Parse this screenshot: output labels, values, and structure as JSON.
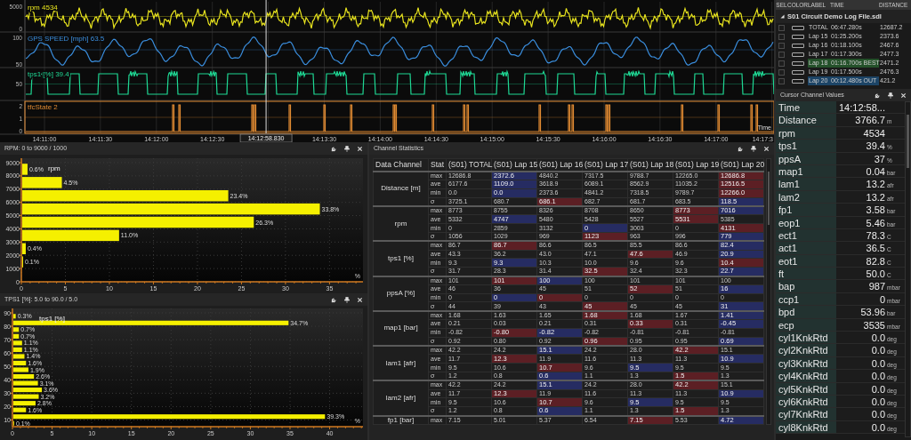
{
  "traces": {
    "lines": [
      {
        "label": "rpm 4534",
        "kind": "jagged",
        "color": "#e8e41e",
        "yticks": [
          "5000",
          "0"
        ]
      },
      {
        "label": "GPS SPEED [mph] 63.5",
        "kind": "smooth",
        "color": "#3a8ddc",
        "yticks": [
          "100",
          "50"
        ]
      },
      {
        "label": "tps1 [%] 39.4",
        "kind": "square",
        "color": "#1fd894",
        "yticks": [
          "50"
        ]
      },
      {
        "label": "tfcState 2",
        "kind": "spikes",
        "color": "#e08a32",
        "yticks": [
          "2",
          "1",
          "0"
        ]
      }
    ],
    "time_ticks": [
      "14:11:00",
      "14:11:30",
      "14:12:00",
      "14:12:30",
      "14:13:30",
      "14:14:00",
      "14:14:30",
      "14:15:00",
      "14:15:30",
      "14:16:00",
      "14:16:30",
      "14:17:00",
      "14:17:3"
    ],
    "cursor_time": "14:12:58.830",
    "axis_label": "Time"
  },
  "histograms": [
    {
      "title": "RPM: 0 to 9000 / 1000",
      "chart_data": {
        "type": "bar",
        "orientation": "horizontal",
        "grid": true,
        "xlabel": "%",
        "x": [
          1500,
          2500,
          3500,
          4500,
          5500,
          6500,
          7500,
          8500
        ],
        "series": [
          {
            "name": "rpm",
            "color": "#f5f000",
            "values": [
              0.1,
              0.4,
              11.0,
              26.3,
              33.8,
              23.4,
              4.5,
              0.6
            ]
          }
        ],
        "value_labels": [
          "0.1%",
          "0.4%",
          "11.0%",
          "26.3%",
          "33.8%",
          "23.4%",
          "4.5%",
          "0.6%"
        ],
        "xlim": [
          0,
          38.8
        ],
        "ylim": [
          0,
          9000
        ],
        "xticks": [
          0,
          5,
          10,
          15,
          20,
          25,
          30,
          35
        ],
        "yticks": [
          0,
          1000,
          2000,
          3000,
          4000,
          5000,
          6000,
          7000,
          8000,
          9000
        ]
      }
    },
    {
      "title": "TPS1 [%]: 5.0 to 90.0 / 5.0",
      "chart_data": {
        "type": "bar",
        "orientation": "horizontal",
        "grid": true,
        "xlabel": "%",
        "x": [
          7.5,
          12.5,
          17.5,
          22.5,
          27.5,
          32.5,
          37.5,
          42.5,
          47.5,
          52.5,
          57.5,
          62.5,
          67.5,
          72.5,
          77.5,
          82.5,
          87.5
        ],
        "series": [
          {
            "name": "tps1 [%]",
            "color": "#f5f000",
            "values": [
              0.1,
              39.3,
              1.6,
              2.8,
              3.2,
              3.6,
              3.1,
              2.6,
              1.9,
              1.6,
              1.4,
              1.1,
              1.1,
              0.7,
              0.7,
              34.7,
              0.3
            ]
          }
        ],
        "value_labels": [
          "0.1%",
          "39.3%",
          "1.6%",
          "2.8%",
          "3.2%",
          "3.6%",
          "3.1%",
          "2.6%",
          "1.9%",
          "1.6%",
          "1.4%",
          "1.1%",
          "1.1%",
          "0.7%",
          "0.7%",
          "34.7%",
          "0.3%"
        ],
        "xlim": [
          0,
          44.2
        ],
        "ylim": [
          5,
          90
        ],
        "xticks": [
          0,
          5,
          10,
          15,
          20,
          25,
          30,
          35,
          40
        ],
        "yticks": [
          10,
          20,
          30,
          40,
          50,
          60,
          70,
          80,
          90
        ]
      }
    }
  ],
  "channel_statistics": {
    "title": "Channel Statistics",
    "columns": [
      "Data Channel",
      "Stat",
      "(S01) TOTAL",
      "(S01) Lap 15",
      "(S01) Lap 16",
      "(S01) Lap 17",
      "(S01) Lap 18",
      "(S01) Lap 19",
      "(S01) Lap 20"
    ],
    "groups": [
      {
        "channel": "Distance [m]",
        "rows": [
          {
            "stat": "max",
            "cells": [
              {
                "value": "12686.8"
              },
              {
                "value": "2372.6",
                "color": "#262c62"
              },
              {
                "value": "4840.2"
              },
              {
                "value": "7317.5"
              },
              {
                "value": "9788.7"
              },
              {
                "value": "12265.0"
              },
              {
                "value": "12686.8",
                "color": "#5c1f24"
              }
            ]
          },
          {
            "stat": "ave",
            "cells": [
              {
                "value": "6177.6"
              },
              {
                "value": "1109.0",
                "color": "#262c62"
              },
              {
                "value": "3618.9"
              },
              {
                "value": "6089.1"
              },
              {
                "value": "8562.9"
              },
              {
                "value": "11035.2"
              },
              {
                "value": "12516.5",
                "color": "#5c1f24"
              }
            ]
          },
          {
            "stat": "min",
            "cells": [
              {
                "value": "0.0"
              },
              {
                "value": "0.0",
                "color": "#262c62"
              },
              {
                "value": "2373.6"
              },
              {
                "value": "4841.2"
              },
              {
                "value": "7318.5"
              },
              {
                "value": "9789.7"
              },
              {
                "value": "12266.0",
                "color": "#5c1f24"
              }
            ]
          },
          {
            "stat": "σ",
            "cells": [
              {
                "value": "3725.1"
              },
              {
                "value": "680.7"
              },
              {
                "value": "686.1",
                "color": "#5c1f24"
              },
              {
                "value": "682.7"
              },
              {
                "value": "681.7"
              },
              {
                "value": "683.5"
              },
              {
                "value": "118.5",
                "color": "#262c62"
              }
            ]
          }
        ]
      },
      {
        "channel": "rpm",
        "rows": [
          {
            "stat": "max",
            "cells": [
              {
                "value": "8773"
              },
              {
                "value": "8755"
              },
              {
                "value": "8326"
              },
              {
                "value": "8708"
              },
              {
                "value": "8650"
              },
              {
                "value": "8773",
                "color": "#5c1f24"
              },
              {
                "value": "7016",
                "color": "#262c62"
              }
            ]
          },
          {
            "stat": "ave",
            "cells": [
              {
                "value": "5332"
              },
              {
                "value": "4747",
                "color": "#262c62"
              },
              {
                "value": "5480"
              },
              {
                "value": "5428"
              },
              {
                "value": "5527"
              },
              {
                "value": "5531",
                "color": "#5c1f24"
              },
              {
                "value": "5385"
              }
            ]
          },
          {
            "stat": "min",
            "cells": [
              {
                "value": "0"
              },
              {
                "value": "2859"
              },
              {
                "value": "3132"
              },
              {
                "value": "0",
                "color": "#262c62"
              },
              {
                "value": "3003"
              },
              {
                "value": "0"
              },
              {
                "value": "4131",
                "color": "#5c1f24"
              }
            ]
          },
          {
            "stat": "σ",
            "cells": [
              {
                "value": "1056"
              },
              {
                "value": "1029"
              },
              {
                "value": "969"
              },
              {
                "value": "1123",
                "color": "#5c1f24"
              },
              {
                "value": "963"
              },
              {
                "value": "996"
              },
              {
                "value": "779",
                "color": "#262c62"
              }
            ]
          }
        ]
      },
      {
        "channel": "tps1 [%]",
        "rows": [
          {
            "stat": "max",
            "cells": [
              {
                "value": "86.7"
              },
              {
                "value": "86.7",
                "color": "#5c1f24"
              },
              {
                "value": "86.6"
              },
              {
                "value": "86.5"
              },
              {
                "value": "85.5"
              },
              {
                "value": "86.6"
              },
              {
                "value": "82.4",
                "color": "#262c62"
              }
            ]
          },
          {
            "stat": "ave",
            "cells": [
              {
                "value": "43.3"
              },
              {
                "value": "36.2"
              },
              {
                "value": "43.0"
              },
              {
                "value": "47.1"
              },
              {
                "value": "47.6",
                "color": "#5c1f24"
              },
              {
                "value": "46.9"
              },
              {
                "value": "20.9",
                "color": "#262c62"
              }
            ]
          },
          {
            "stat": "min",
            "cells": [
              {
                "value": "9.3"
              },
              {
                "value": "9.3",
                "color": "#262c62"
              },
              {
                "value": "10.3"
              },
              {
                "value": "10.0"
              },
              {
                "value": "9.6"
              },
              {
                "value": "9.6"
              },
              {
                "value": "10.4",
                "color": "#5c1f24"
              }
            ]
          },
          {
            "stat": "σ",
            "cells": [
              {
                "value": "31.7"
              },
              {
                "value": "28.3"
              },
              {
                "value": "31.4"
              },
              {
                "value": "32.5",
                "color": "#5c1f24"
              },
              {
                "value": "32.4"
              },
              {
                "value": "32.3"
              },
              {
                "value": "22.7",
                "color": "#262c62"
              }
            ]
          }
        ]
      },
      {
        "channel": "ppsA [%]",
        "rows": [
          {
            "stat": "max",
            "cells": [
              {
                "value": "101"
              },
              {
                "value": "101",
                "color": "#5c1f24"
              },
              {
                "value": "100",
                "color": "#262c62"
              },
              {
                "value": "100"
              },
              {
                "value": "101"
              },
              {
                "value": "101"
              },
              {
                "value": "100"
              }
            ]
          },
          {
            "stat": "ave",
            "cells": [
              {
                "value": "46"
              },
              {
                "value": "36"
              },
              {
                "value": "45"
              },
              {
                "value": "51"
              },
              {
                "value": "52",
                "color": "#5c1f24"
              },
              {
                "value": "51"
              },
              {
                "value": "16",
                "color": "#262c62"
              }
            ]
          },
          {
            "stat": "min",
            "cells": [
              {
                "value": "0"
              },
              {
                "value": "0",
                "color": "#262c62"
              },
              {
                "value": "0",
                "color": "#5c1f24"
              },
              {
                "value": "0"
              },
              {
                "value": "0"
              },
              {
                "value": "0"
              },
              {
                "value": "0"
              }
            ]
          },
          {
            "stat": "σ",
            "cells": [
              {
                "value": "44"
              },
              {
                "value": "39"
              },
              {
                "value": "43"
              },
              {
                "value": "45",
                "color": "#5c1f24"
              },
              {
                "value": "45"
              },
              {
                "value": "45"
              },
              {
                "value": "31",
                "color": "#262c62"
              }
            ]
          }
        ]
      },
      {
        "channel": "map1 [bar]",
        "rows": [
          {
            "stat": "max",
            "cells": [
              {
                "value": "1.68"
              },
              {
                "value": "1.63"
              },
              {
                "value": "1.65"
              },
              {
                "value": "1.68",
                "color": "#5c1f24"
              },
              {
                "value": "1.68"
              },
              {
                "value": "1.67"
              },
              {
                "value": "1.41",
                "color": "#262c62"
              }
            ]
          },
          {
            "stat": "ave",
            "cells": [
              {
                "value": "0.21"
              },
              {
                "value": "0.03"
              },
              {
                "value": "0.21"
              },
              {
                "value": "0.31"
              },
              {
                "value": "0.33",
                "color": "#5c1f24"
              },
              {
                "value": "0.31"
              },
              {
                "value": "-0.45",
                "color": "#262c62"
              }
            ]
          },
          {
            "stat": "min",
            "cells": [
              {
                "value": "-0.82"
              },
              {
                "value": "-0.80",
                "color": "#5c1f24"
              },
              {
                "value": "-0.82",
                "color": "#262c62"
              },
              {
                "value": "-0.82"
              },
              {
                "value": "-0.81"
              },
              {
                "value": "-0.81"
              },
              {
                "value": "-0.81"
              }
            ]
          },
          {
            "stat": "σ",
            "cells": [
              {
                "value": "0.92"
              },
              {
                "value": "0.80"
              },
              {
                "value": "0.92"
              },
              {
                "value": "0.96",
                "color": "#5c1f24"
              },
              {
                "value": "0.95"
              },
              {
                "value": "0.95"
              },
              {
                "value": "0.69",
                "color": "#262c62"
              }
            ]
          }
        ]
      },
      {
        "channel": "lam1 [afr]",
        "rows": [
          {
            "stat": "max",
            "cells": [
              {
                "value": "42.2"
              },
              {
                "value": "24.2"
              },
              {
                "value": "15.1",
                "color": "#262c62"
              },
              {
                "value": "24.2"
              },
              {
                "value": "28.0"
              },
              {
                "value": "42.2",
                "color": "#5c1f24"
              },
              {
                "value": "15.1"
              }
            ]
          },
          {
            "stat": "ave",
            "cells": [
              {
                "value": "11.7"
              },
              {
                "value": "12.3",
                "color": "#5c1f24"
              },
              {
                "value": "11.9"
              },
              {
                "value": "11.6"
              },
              {
                "value": "11.3"
              },
              {
                "value": "11.3"
              },
              {
                "value": "10.9",
                "color": "#262c62"
              }
            ]
          },
          {
            "stat": "min",
            "cells": [
              {
                "value": "9.5"
              },
              {
                "value": "10.6"
              },
              {
                "value": "10.7",
                "color": "#5c1f24"
              },
              {
                "value": "9.6"
              },
              {
                "value": "9.5",
                "color": "#262c62"
              },
              {
                "value": "9.5"
              },
              {
                "value": "9.5"
              }
            ]
          },
          {
            "stat": "σ",
            "cells": [
              {
                "value": "1.2"
              },
              {
                "value": "0.8"
              },
              {
                "value": "0.6",
                "color": "#262c62"
              },
              {
                "value": "1.1"
              },
              {
                "value": "1.3"
              },
              {
                "value": "1.5",
                "color": "#5c1f24"
              },
              {
                "value": "1.3"
              }
            ]
          }
        ]
      },
      {
        "channel": "lam2 [afr]",
        "rows": [
          {
            "stat": "max",
            "cells": [
              {
                "value": "42.2"
              },
              {
                "value": "24.2"
              },
              {
                "value": "15.1",
                "color": "#262c62"
              },
              {
                "value": "24.2"
              },
              {
                "value": "28.0"
              },
              {
                "value": "42.2",
                "color": "#5c1f24"
              },
              {
                "value": "15.1"
              }
            ]
          },
          {
            "stat": "ave",
            "cells": [
              {
                "value": "11.7"
              },
              {
                "value": "12.3",
                "color": "#5c1f24"
              },
              {
                "value": "11.9"
              },
              {
                "value": "11.6"
              },
              {
                "value": "11.3"
              },
              {
                "value": "11.3"
              },
              {
                "value": "10.9",
                "color": "#262c62"
              }
            ]
          },
          {
            "stat": "min",
            "cells": [
              {
                "value": "9.5"
              },
              {
                "value": "10.6"
              },
              {
                "value": "10.7",
                "color": "#5c1f24"
              },
              {
                "value": "9.6"
              },
              {
                "value": "9.5",
                "color": "#262c62"
              },
              {
                "value": "9.5"
              },
              {
                "value": "9.5"
              }
            ]
          },
          {
            "stat": "σ",
            "cells": [
              {
                "value": "1.2"
              },
              {
                "value": "0.8"
              },
              {
                "value": "0.6",
                "color": "#262c62"
              },
              {
                "value": "1.1"
              },
              {
                "value": "1.3"
              },
              {
                "value": "1.5",
                "color": "#5c1f24"
              },
              {
                "value": "1.3"
              }
            ]
          }
        ]
      },
      {
        "channel": "fp1 [bar]",
        "rows": [
          {
            "stat": "max",
            "cells": [
              {
                "value": "7.15"
              },
              {
                "value": "5.01"
              },
              {
                "value": "5.37"
              },
              {
                "value": "6.54"
              },
              {
                "value": "7.15",
                "color": "#5c1f24"
              },
              {
                "value": "5.53"
              },
              {
                "value": "4.72",
                "color": "#262c62"
              }
            ]
          }
        ]
      }
    ]
  },
  "laps": {
    "columns": [
      "SEL",
      "COLOR",
      "LABEL",
      "TIME",
      "DISTANCE"
    ],
    "file": "S01 Circuit Demo Log File.sdl",
    "expanded": true,
    "rows": [
      {
        "label": "TOTAL",
        "time": "06:47.280s",
        "distance": "12687.2",
        "kind": "normal",
        "selected": false
      },
      {
        "label": "Lap 15",
        "time": "01:25.200s",
        "distance": "2373.6",
        "kind": "normal",
        "selected": false
      },
      {
        "label": "Lap 16",
        "time": "01:18.100s",
        "distance": "2467.6",
        "kind": "normal",
        "selected": false
      },
      {
        "label": "Lap 17",
        "time": "01:17.300s",
        "distance": "2477.3",
        "kind": "normal",
        "selected": false
      },
      {
        "label": "Lap 18",
        "time": "01:16.700s BEST",
        "distance": "2471.2",
        "kind": "best",
        "selected": false
      },
      {
        "label": "Lap 19",
        "time": "01:17.500s",
        "distance": "2476.3",
        "kind": "normal",
        "selected": false
      },
      {
        "label": "Lap 20",
        "time": "00:12.480s OUT",
        "distance": "421.2",
        "kind": "out",
        "selected": false
      }
    ]
  },
  "cursor_values": {
    "title": "Cursor Channel Values",
    "rows": [
      {
        "name": "Time",
        "value": "14:12:58..."
      },
      {
        "name": "Distance",
        "value": "3766.7",
        "unit": "m"
      },
      {
        "name": "rpm",
        "value": "4534"
      },
      {
        "name": "tps1",
        "value": "39.4",
        "unit": "%"
      },
      {
        "name": "ppsA",
        "value": "37",
        "unit": "%"
      },
      {
        "name": "map1",
        "value": "0.04",
        "unit": "bar"
      },
      {
        "name": "lam1",
        "value": "13.2",
        "unit": "afr"
      },
      {
        "name": "lam2",
        "value": "13.2",
        "unit": "afr"
      },
      {
        "name": "fp1",
        "value": "3.58",
        "unit": "bar"
      },
      {
        "name": "eop1",
        "value": "5.46",
        "unit": "bar"
      },
      {
        "name": "ect1",
        "value": "78.3",
        "unit": "C"
      },
      {
        "name": "act1",
        "value": "36.5",
        "unit": "C"
      },
      {
        "name": "eot1",
        "value": "82.8",
        "unit": "C"
      },
      {
        "name": "ft",
        "value": "50.0",
        "unit": "C"
      },
      {
        "name": "bap",
        "value": "987",
        "unit": "mbar"
      },
      {
        "name": "ccp1",
        "value": "0",
        "unit": "mbar"
      },
      {
        "name": "bpd",
        "value": "53.96",
        "unit": "bar"
      },
      {
        "name": "ecp",
        "value": "3535",
        "unit": "mbar"
      },
      {
        "name": "cyl1KnkRtd",
        "value": "0.0",
        "unit": "deg"
      },
      {
        "name": "cyl2KnkRtd",
        "value": "0.0",
        "unit": "deg"
      },
      {
        "name": "cyl3KnkRtd",
        "value": "0.0",
        "unit": "deg"
      },
      {
        "name": "cyl4KnkRtd",
        "value": "0.0",
        "unit": "deg"
      },
      {
        "name": "cyl5KnkRtd",
        "value": "0.0",
        "unit": "deg"
      },
      {
        "name": "cyl6KnkRtd",
        "value": "0.0",
        "unit": "deg"
      },
      {
        "name": "cyl7KnkRtd",
        "value": "0.0",
        "unit": "deg"
      },
      {
        "name": "cyl8KnkRtd",
        "value": "0.0",
        "unit": "deg"
      }
    ]
  }
}
